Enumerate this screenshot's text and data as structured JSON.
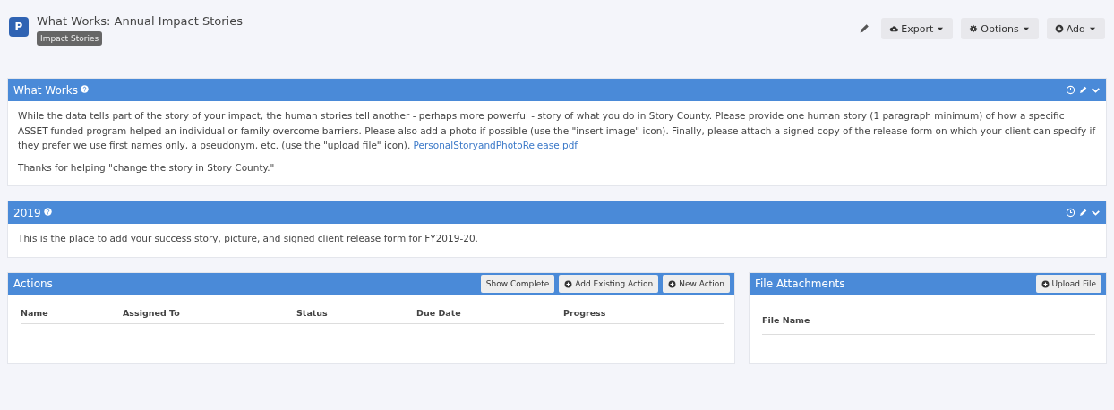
{
  "header": {
    "badge": "P",
    "title": "What Works: Annual Impact Stories",
    "tag": "Impact Stories",
    "buttons": [
      {
        "label": "Export",
        "kind": "cloud",
        "caret": true
      },
      {
        "label": "Options",
        "kind": "gear",
        "caret": true
      },
      {
        "label": "Add",
        "kind": "plus",
        "caret": true
      }
    ]
  },
  "sections": [
    {
      "title": "What Works",
      "paragraphs": [
        {
          "text": "While the data tells part of the story of your impact, the human stories tell another - perhaps more powerful - story of what you do in Story County. Please provide one human story (1 paragraph minimum) of how a specific ASSET-funded program helped an individual or family overcome barriers. Please also add a photo if possible (use the \"insert image\" icon). Finally, please attach a signed copy of the release form on which your client can specify if they prefer we use first names only, a pseudonym, etc. (use the \"upload file\" icon).",
          "link": "PersonalStoryandPhotoRelease.pdf"
        },
        {
          "text": "Thanks for helping \"change the story in Story County.\""
        }
      ]
    },
    {
      "title": "2019",
      "paragraphs": [
        {
          "text": "This is the place to add your success story, picture, and signed client release form for FY2019-20."
        }
      ]
    }
  ],
  "actions": {
    "title": "Actions",
    "buttons": [
      {
        "label": "Show Complete",
        "kind": "plain"
      },
      {
        "label": "Add Existing Action",
        "kind": "plus"
      },
      {
        "label": "New Action",
        "kind": "plus"
      }
    ],
    "columns": [
      "Name",
      "Assigned To",
      "Status",
      "Due Date",
      "Progress"
    ]
  },
  "attachments": {
    "title": "File Attachments",
    "buttons": [
      {
        "label": "Upload File",
        "kind": "plus"
      }
    ],
    "columns": [
      "File Name"
    ]
  }
}
